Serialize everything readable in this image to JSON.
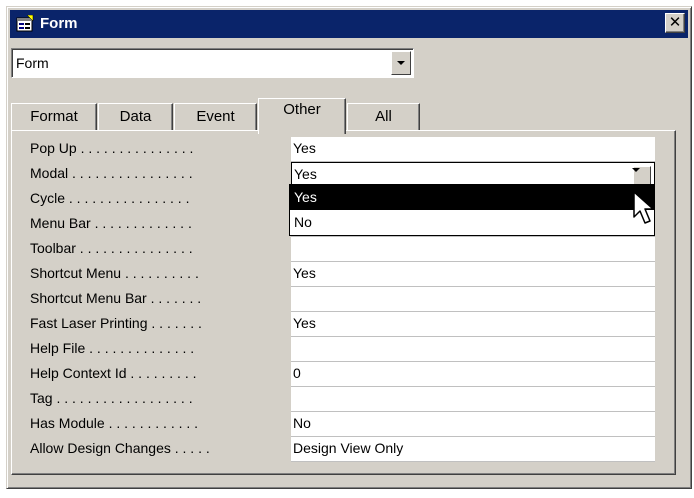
{
  "window": {
    "title": "Form",
    "close_glyph": "✕"
  },
  "selector": {
    "value": "Form"
  },
  "tabs": [
    {
      "label": "Format"
    },
    {
      "label": "Data"
    },
    {
      "label": "Event"
    },
    {
      "label": "Other"
    },
    {
      "label": "All"
    }
  ],
  "active_tab": "Other",
  "properties": [
    {
      "label": "Pop Up . . . . . . . . . . . . . . .",
      "value": "Yes"
    },
    {
      "label": "Modal . . . . . . . . . . . . . . . .",
      "value": "Yes"
    },
    {
      "label": "Cycle . . . . . . . . . . . . . . . .",
      "value": ""
    },
    {
      "label": "Menu Bar . . . . . . . . . . . . .",
      "value": ""
    },
    {
      "label": "Toolbar . . . . . . . . . . . . . . .",
      "value": ""
    },
    {
      "label": "Shortcut Menu . . . . . . . . . .",
      "value": "Yes"
    },
    {
      "label": "Shortcut Menu Bar . . . . . . .",
      "value": ""
    },
    {
      "label": "Fast Laser Printing . . . . . . .",
      "value": "Yes"
    },
    {
      "label": "Help File . . . . . . . . . . . . . .",
      "value": ""
    },
    {
      "label": "Help Context Id . . . . . . . . .",
      "value": "0"
    },
    {
      "label": "Tag . . . . . . . . . . . . . . . . . .",
      "value": ""
    },
    {
      "label": "Has Module . . . . . . . . . . . .",
      "value": "No"
    },
    {
      "label": "Allow Design Changes . . . . .",
      "value": "Design View Only"
    }
  ],
  "dropdown": {
    "options": [
      "Yes",
      "No"
    ],
    "highlighted": "Yes"
  },
  "colors": {
    "titlebar": "#0a246a",
    "face": "#d4d0c8",
    "highlight": "#000000"
  },
  "icons": [
    "form-icon",
    "close-icon",
    "chevron-down-icon",
    "mouse-pointer-icon"
  ]
}
